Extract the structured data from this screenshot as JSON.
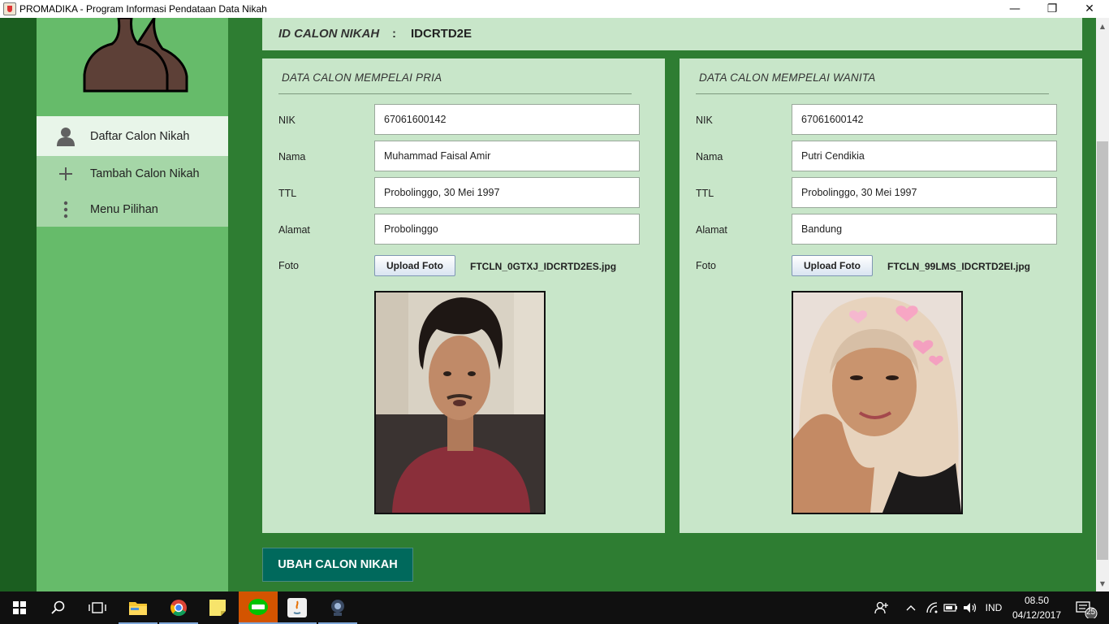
{
  "window": {
    "title": "PROMADIKA - Program Informasi Pendataan Data Nikah",
    "minimize_glyph": "—",
    "maximize_glyph": "❐",
    "close_glyph": "✕"
  },
  "sidebar": {
    "items": [
      {
        "label": "Daftar Calon Nikah",
        "icon": "person-icon",
        "selected": true
      },
      {
        "label": "Tambah Calon Nikah",
        "icon": "plus-icon",
        "selected": false
      },
      {
        "label": "Menu Pilihan",
        "icon": "more-vertical-icon",
        "selected": false
      }
    ]
  },
  "header": {
    "id_label": "ID CALON NIKAH",
    "separator": ":",
    "id_value": "IDCRTD2E"
  },
  "pria": {
    "title": "DATA CALON MEMPELAI PRIA",
    "nik_label": "NIK",
    "nik": "67061600142",
    "nama_label": "Nama",
    "nama": "Muhammad Faisal Amir",
    "ttl_label": "TTL",
    "ttl": "Probolinggo, 30 Mei 1997",
    "alamat_label": "Alamat",
    "alamat": "Probolinggo",
    "foto_label": "Foto",
    "upload_label": "Upload Foto",
    "file_name": "FTCLN_0GTXJ_IDCRTD2ES.jpg"
  },
  "wanita": {
    "title": "DATA CALON MEMPELAI WANITA",
    "nik_label": "NIK",
    "nik": "67061600142",
    "nama_label": "Nama",
    "nama": "Putri Cendikia",
    "ttl_label": "TTL",
    "ttl": "Probolinggo, 30 Mei 1997",
    "alamat_label": "Alamat",
    "alamat": "Bandung",
    "foto_label": "Foto",
    "upload_label": "Upload Foto",
    "file_name": "FTCLN_99LMS_IDCRTD2EI.jpg"
  },
  "actions": {
    "ubah_label": "UBAH CALON NIKAH"
  },
  "taskbar": {
    "apps": [
      "windows-start-icon",
      "search-icon",
      "task-view-icon",
      "file-explorer-icon",
      "chrome-icon",
      "sticky-notes-icon",
      "line-icon",
      "java-icon",
      "webcam-icon"
    ],
    "tray_language": "IND",
    "time": "08.50",
    "date": "04/12/2017",
    "notification_count": "25"
  },
  "colors": {
    "background": "#2e7d32",
    "sidebar": "#66bb6a",
    "panel": "#c8e6c9",
    "button": "#00695c"
  }
}
